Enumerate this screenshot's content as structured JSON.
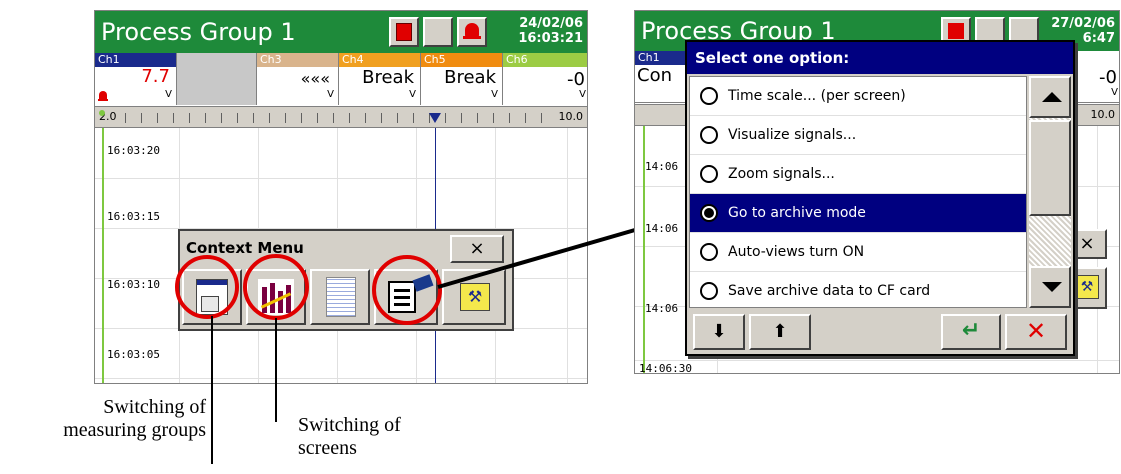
{
  "left_screen": {
    "title": "Process Group 1",
    "date": "24/02/06",
    "time": "16:03:21",
    "channels": [
      {
        "tag": "Ch1",
        "value": "7.7",
        "unit": "V",
        "color": "#1a2a8c"
      },
      {
        "tag": "",
        "value": "",
        "unit": "",
        "color": "#c0c0c0"
      },
      {
        "tag": "Ch3",
        "value": "«««",
        "unit": "V",
        "color": "#d9b48c"
      },
      {
        "tag": "Ch4",
        "value": "Break",
        "unit": "V",
        "color": "#f0a020"
      },
      {
        "tag": "Ch5",
        "value": "Break",
        "unit": "V",
        "color": "#f08c10"
      },
      {
        "tag": "Ch6",
        "value": "-0",
        "unit": "V",
        "color": "#9ccc44"
      }
    ],
    "scale_min": "2.0",
    "scale_max": "10.0",
    "times": [
      "16:03:20",
      "16:03:15",
      "16:03:10",
      "16:03:05"
    ],
    "context_menu": {
      "title": "Context Menu",
      "close": "×"
    }
  },
  "right_screen": {
    "title": "Process Group 1",
    "date": "27/02/06",
    "time": "6:47",
    "ch1_tag": "Ch1",
    "ch1_value": "Con",
    "ch_right_value": "-0",
    "ch_right_unit": "V",
    "scale_max": "10.0",
    "times": [
      "14:06",
      "14:06",
      "14:06"
    ],
    "bottom_time": "14:06:30",
    "dialog": {
      "title": "Select one option:",
      "options": [
        {
          "label": "Time scale... (per screen)",
          "selected": false
        },
        {
          "label": "Visualize signals...",
          "selected": false
        },
        {
          "label": "Zoom signals...",
          "selected": false
        },
        {
          "label": "Go to archive mode",
          "selected": true
        },
        {
          "label": "Auto-views turn ON",
          "selected": false
        },
        {
          "label": "Save archive data to CF card",
          "selected": false
        }
      ]
    }
  },
  "captions": {
    "groups_line1": "Switching of",
    "groups_line2": "measuring groups",
    "screens_line1": "Switching of",
    "screens_line2": "screens"
  },
  "colors": {
    "title_green": "#1e8a3a",
    "dialog_blue": "#000080",
    "highlight_red": "#e00000"
  }
}
